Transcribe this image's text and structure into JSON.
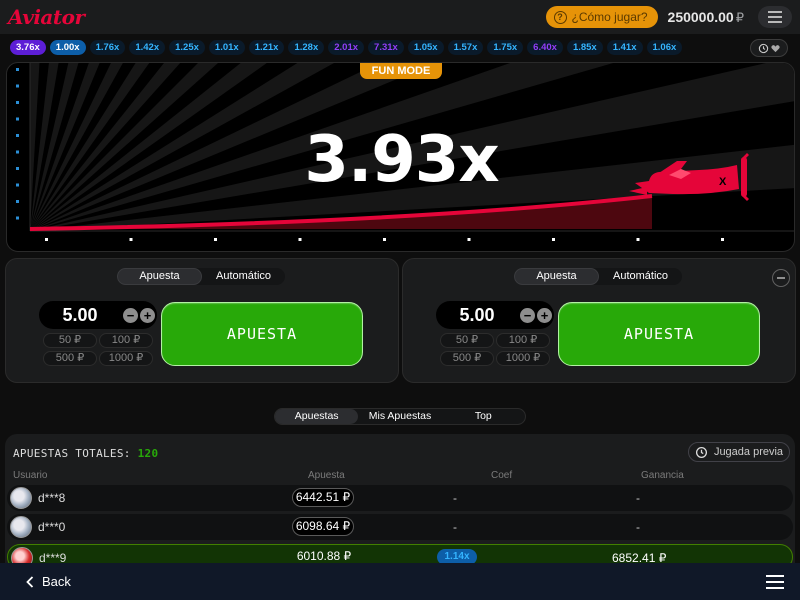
{
  "header": {
    "logo": "Aviator",
    "how_to_play": "¿Cómo jugar?",
    "balance": "250000.00",
    "currency": "₽"
  },
  "history": [
    "3.76x",
    "1.00x",
    "1.76x",
    "1.42x",
    "1.25x",
    "1.01x",
    "1.21x",
    "1.28x",
    "2.01x",
    "7.31x",
    "1.05x",
    "1.57x",
    "1.75x",
    "6.40x",
    "1.85x",
    "1.41x",
    "1.06x"
  ],
  "game": {
    "mode_badge": "FUN MODE",
    "multiplier": "3.93x"
  },
  "bet_panels": [
    {
      "tabs": [
        "Apuesta",
        "Automático"
      ],
      "active_tab": "Apuesta",
      "amount": "5.00",
      "quick": [
        "50 ₽",
        "100 ₽",
        "500 ₽",
        "1000 ₽"
      ],
      "button": "APUESTA"
    },
    {
      "tabs": [
        "Apuesta",
        "Automático"
      ],
      "active_tab": "Apuesta",
      "amount": "5.00",
      "quick": [
        "50 ₽",
        "100 ₽",
        "500 ₽",
        "1000 ₽"
      ],
      "button": "APUESTA"
    }
  ],
  "bets_tabs": [
    "Apuestas",
    "Mis Apuestas",
    "Top"
  ],
  "bets": {
    "total_label": "APUESTAS TOTALES:",
    "total_count": "120",
    "prev_round": "Jugada previa",
    "columns": {
      "user": "Usuario",
      "bet": "Apuesta",
      "coef": "Coef",
      "win": "Ganancia"
    },
    "rows": [
      {
        "user": "d***8",
        "bet": "6442.51 ₽",
        "coef": "-",
        "win": "-"
      },
      {
        "user": "d***0",
        "bet": "6098.64 ₽",
        "coef": "-",
        "win": "-"
      },
      {
        "user": "d***9",
        "bet": "6010.88 ₽",
        "coef": "1.14x",
        "win": "6852.41 ₽"
      }
    ]
  },
  "footer": {
    "back": "Back"
  },
  "colors": {
    "accent_red": "#e50539",
    "bet_green": "#28a909",
    "fun_mode": "#e69308",
    "history_blue": "#34b4ff",
    "history_purple": "#913ef8"
  }
}
